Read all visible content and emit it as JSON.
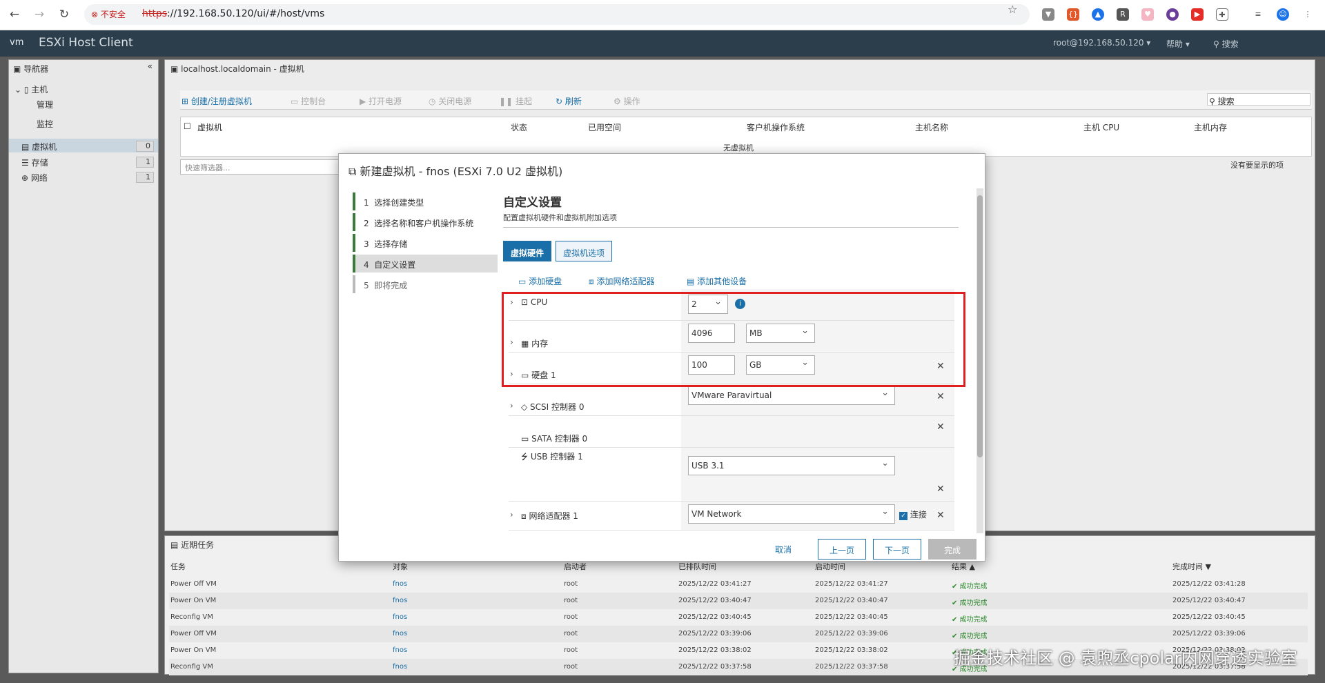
{
  "browser": {
    "security_label": "不安全",
    "url_scheme": "https",
    "url_rest": "://192.168.50.120/ui/#/host/vms"
  },
  "app": {
    "logo": "vm",
    "title": "ESXi Host Client",
    "user": "root@192.168.50.120 ▾",
    "help": "帮助 ▾",
    "search": "搜索"
  },
  "navigator": {
    "title": "导航器",
    "host": "主机",
    "manage": "管理",
    "monitor": "监控",
    "vms": {
      "label": "虚拟机",
      "count": "0"
    },
    "storage": {
      "label": "存储",
      "count": "1"
    },
    "network": {
      "label": "网络",
      "count": "1"
    }
  },
  "main": {
    "breadcrumb": "localhost.localdomain - 虚拟机",
    "toolbar": {
      "create": "创建/注册虚拟机",
      "console": "控制台",
      "power_on": "打开电源",
      "power_off": "关闭电源",
      "suspend": "挂起",
      "refresh": "刷新",
      "actions": "操作",
      "search": "搜索"
    },
    "columns": [
      "虚拟机",
      "状态",
      "已用空间",
      "客户机操作系统",
      "主机名称",
      "主机 CPU",
      "主机内存"
    ],
    "empty": "无虚拟机",
    "filter_placeholder": "快速筛选器...",
    "no_items": "没有要显示的项"
  },
  "tasks": {
    "title": "近期任务",
    "columns": [
      "任务",
      "对象",
      "启动者",
      "已排队时间",
      "启动时间",
      "结果 ▲",
      "完成时间 ▼"
    ],
    "rows": [
      {
        "task": "Power Off VM",
        "target": "fnos",
        "initiator": "root",
        "queued": "2025/12/22 03:41:27",
        "started": "2025/12/22 03:41:27",
        "result": "成功完成",
        "completed": "2025/12/22 03:41:28"
      },
      {
        "task": "Power On VM",
        "target": "fnos",
        "initiator": "root",
        "queued": "2025/12/22 03:40:47",
        "started": "2025/12/22 03:40:47",
        "result": "成功完成",
        "completed": "2025/12/22 03:40:47"
      },
      {
        "task": "Reconfig VM",
        "target": "fnos",
        "initiator": "root",
        "queued": "2025/12/22 03:40:45",
        "started": "2025/12/22 03:40:45",
        "result": "成功完成",
        "completed": "2025/12/22 03:40:45"
      },
      {
        "task": "Power Off VM",
        "target": "fnos",
        "initiator": "root",
        "queued": "2025/12/22 03:39:06",
        "started": "2025/12/22 03:39:06",
        "result": "成功完成",
        "completed": "2025/12/22 03:39:06"
      },
      {
        "task": "Power On VM",
        "target": "fnos",
        "initiator": "root",
        "queued": "2025/12/22 03:38:02",
        "started": "2025/12/22 03:38:02",
        "result": "成功完成",
        "completed": "2025/12/22 03:38:02"
      },
      {
        "task": "Reconfig VM",
        "target": "fnos",
        "initiator": "root",
        "queued": "2025/12/22 03:37:58",
        "started": "2025/12/22 03:37:58",
        "result": "成功完成",
        "completed": "2025/12/22 03:37:58"
      }
    ]
  },
  "modal": {
    "title": "新建虚拟机 - fnos (ESXi 7.0 U2 虚拟机)",
    "steps": [
      {
        "num": "1",
        "label": "选择创建类型"
      },
      {
        "num": "2",
        "label": "选择名称和客户机操作系统"
      },
      {
        "num": "3",
        "label": "选择存储"
      },
      {
        "num": "4",
        "label": "自定义设置"
      },
      {
        "num": "5",
        "label": "即将完成"
      }
    ],
    "heading": "自定义设置",
    "subheading": "配置虚拟机硬件和虚拟机附加选项",
    "tabs": {
      "hardware": "虚拟硬件",
      "options": "虚拟机选项"
    },
    "add": {
      "disk": "添加硬盘",
      "nic": "添加网络适配器",
      "other": "添加其他设备"
    },
    "hardware": {
      "cpu": {
        "label": "CPU",
        "value": "2"
      },
      "memory": {
        "label": "内存",
        "value": "4096",
        "unit": "MB"
      },
      "disk": {
        "label": "硬盘 1",
        "value": "100",
        "unit": "GB"
      },
      "scsi": {
        "label": "SCSI 控制器 0",
        "value": "VMware Paravirtual"
      },
      "sata": {
        "label": "SATA 控制器 0"
      },
      "usb": {
        "label": "USB 控制器 1",
        "value": "USB 3.1"
      },
      "nic": {
        "label": "网络适配器 1",
        "value": "VM Network",
        "connect": "连接"
      }
    },
    "buttons": {
      "cancel": "取消",
      "back": "上一页",
      "next": "下一页",
      "finish": "完成"
    }
  },
  "watermark": "掘金技术社区 @ 袁煦丞cpolar内网穿透实验室"
}
